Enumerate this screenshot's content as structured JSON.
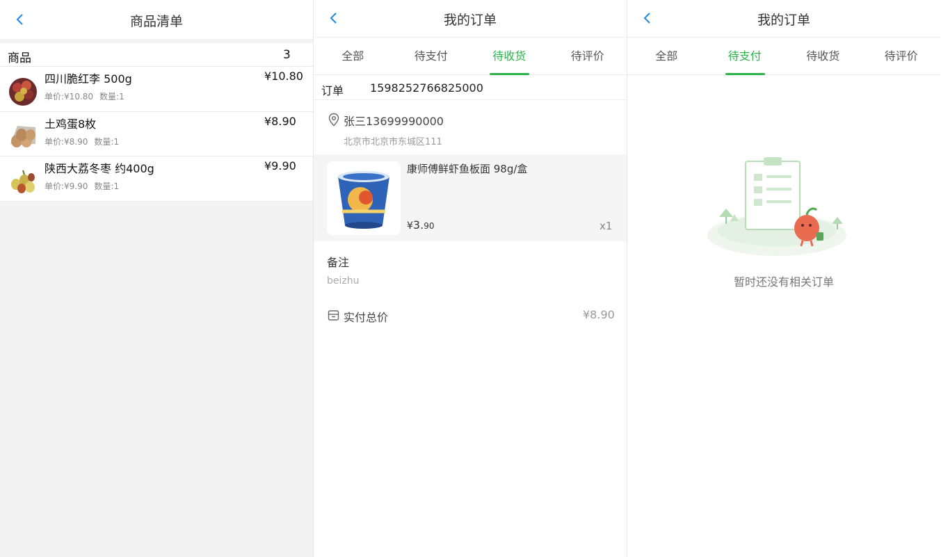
{
  "panel1": {
    "title": "商品清单",
    "header": {
      "label": "商品",
      "count": "3"
    },
    "items": [
      {
        "name": "四川脆红李 500g",
        "price": "¥10.80",
        "unit_price": "单价:¥10.80",
        "qty": "数量:1",
        "image": "plum-image"
      },
      {
        "name": "土鸡蛋8枚",
        "price": "¥8.90",
        "unit_price": "单价:¥8.90",
        "qty": "数量:1",
        "image": "eggs-image"
      },
      {
        "name": "陕西大荔冬枣 约400g",
        "price": "¥9.90",
        "unit_price": "单价:¥9.90",
        "qty": "数量:1",
        "image": "jujube-image"
      }
    ]
  },
  "panel2": {
    "title": "我的订单",
    "tabs": [
      "全部",
      "待支付",
      "待收货",
      "待评价"
    ],
    "active_tab": "待收货",
    "order": {
      "label": "订单",
      "number": "1598252766825000",
      "address_name": "张三13699990000",
      "address_detail": "北京市北京市东城区111",
      "goods": {
        "name": "康师傅鲜虾鱼板面 98g/盒",
        "price_currency": "¥",
        "price_int": "3.",
        "price_dec": "90",
        "qty": "x1",
        "image": "noodle-cup-image"
      },
      "remark_label": "备注",
      "remark_value": "beizhu",
      "total_label": "实付总价",
      "total_value": "¥8.90"
    }
  },
  "panel3": {
    "title": "我的订单",
    "tabs": [
      "全部",
      "待支付",
      "待收货",
      "待评价"
    ],
    "active_tab": "待支付",
    "empty_text": "暂时还没有相关订单",
    "illustration": "empty-orders-illustration"
  },
  "colors": {
    "accent": "#2bb34a",
    "back_arrow": "#1e88e5",
    "background": "#f3f3f3",
    "goods_bg": "#f5f5f5"
  }
}
